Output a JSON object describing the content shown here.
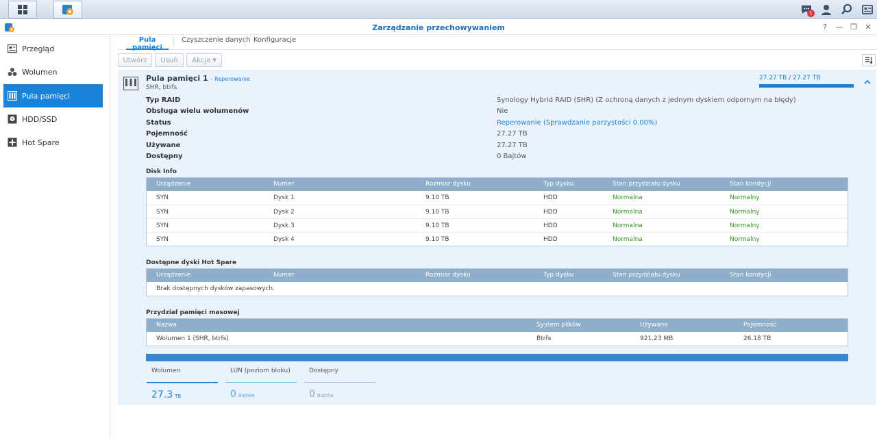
{
  "taskbar": {
    "notification_count": "1"
  },
  "window": {
    "title": "Zarządzanie przechowywaniem",
    "controls": [
      "?",
      "—",
      "❐",
      "✕"
    ]
  },
  "sidebar": {
    "items": [
      {
        "label": "Przegląd",
        "icon": "overview-icon",
        "active": false
      },
      {
        "label": "Wolumen",
        "icon": "volume-icon",
        "active": false
      },
      {
        "label": "Pula pamięci",
        "icon": "storage-pool-icon",
        "active": true
      },
      {
        "label": "HDD/SSD",
        "icon": "hdd-icon",
        "active": false
      },
      {
        "label": "Hot Spare",
        "icon": "hot-spare-icon",
        "active": false
      }
    ]
  },
  "tabs": [
    {
      "label": "Pula pamięci",
      "active": true
    },
    {
      "label": "Czyszczenie danych",
      "active": false
    },
    {
      "label": "Konfiguracje",
      "active": false
    }
  ],
  "toolbar": {
    "create_label": "Utwórz",
    "delete_label": "Usuń",
    "action_label": "Akcja"
  },
  "pool": {
    "title": "Pula pamięci 1",
    "status_link": "- Reperowanie",
    "subtitle": "SHR, btrfs",
    "usage_used": "27.27 TB",
    "usage_sep": "/",
    "usage_total": "27.27 TB",
    "usage_fraction": 1.0,
    "properties": [
      {
        "label": "Typ RAID",
        "value": "Synology Hybrid RAID (SHR) (Z ochroną danych z jednym dyskiem odpornym na błędy)",
        "link": false
      },
      {
        "label": "Obsługa wielu wolumenów",
        "value": "Nie",
        "link": false
      },
      {
        "label": "Status",
        "value": "Reperowanie (Sprawdzanie parzystości 0.00%)",
        "link": true
      },
      {
        "label": "Pojemność",
        "value": "27.27 TB",
        "link": false
      },
      {
        "label": "Używane",
        "value": "27.27 TB",
        "link": false
      },
      {
        "label": "Dostępny",
        "value": "0 Bajtów",
        "link": false
      }
    ]
  },
  "disk_info": {
    "title": "Disk Info",
    "columns": [
      "Urządzenie",
      "Numer",
      "Rozmiar dysku",
      "Typ dysku",
      "Stan przydziału dysku",
      "Stan kondycji"
    ],
    "rows": [
      [
        "SYN",
        "Dysk 1",
        "9.10 TB",
        "HDD",
        "Normalna",
        "Normalny"
      ],
      [
        "SYN",
        "Dysk 2",
        "9.10 TB",
        "HDD",
        "Normalna",
        "Normalny"
      ],
      [
        "SYN",
        "Dysk 3",
        "9.10 TB",
        "HDD",
        "Normalna",
        "Normalny"
      ],
      [
        "SYN",
        "Dysk 4",
        "9.10 TB",
        "HDD",
        "Normalna",
        "Normalny"
      ]
    ]
  },
  "hot_spare": {
    "title": "Dostępne dyski Hot Spare",
    "columns": [
      "Urządzenie",
      "Numer",
      "Rozmiar dysku",
      "Typ dysku",
      "Stan przydziału dysku",
      "Stan kondycji"
    ],
    "empty_text": "Brak dostępnych dysków zapasowych."
  },
  "allocation": {
    "title": "Przydział pamięci masowej",
    "columns": [
      "Nazwa",
      "System plików",
      "Używane",
      "Pojemność"
    ],
    "rows": [
      [
        "Wolumen 1 (SHR, btrfs)",
        "Btrfs",
        "921.23 MB",
        "26.18 TB"
      ]
    ]
  },
  "stats": [
    {
      "label": "Wolumen",
      "value": "27.3",
      "unit": "TB"
    },
    {
      "label": "LUN (poziom bloku)",
      "value": "0",
      "unit": "Bajtów"
    },
    {
      "label": "Dostępny",
      "value": "0",
      "unit": "Bajtów"
    }
  ],
  "colors": {
    "accent": "#1a82d9",
    "healthy": "#2f9a1e",
    "grid_header": "#8eaec9",
    "panel_bg": "#eaf3fb"
  }
}
